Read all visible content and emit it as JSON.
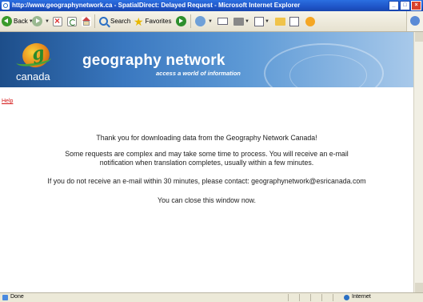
{
  "window": {
    "title": "http://www.geographynetwork.ca - SpatialDirect: Delayed Request - Microsoft Internet Explorer",
    "minimize_label": "_",
    "maximize_label": "□",
    "close_label": "×"
  },
  "toolbar": {
    "back_label": "Back",
    "search_label": "Search",
    "favorites_label": "Favorites"
  },
  "banner": {
    "logo_letter": "g",
    "logo_text": "canada",
    "site_title": "geography network",
    "tagline": "access a world of information"
  },
  "page": {
    "help_link": "Help",
    "message_1": "Thank you for downloading data from the Geography Network Canada!",
    "message_2_line_1": "Some requests are complex and may take some time to process. You will receive an e-mail",
    "message_2_line_2": "notification when translation completes, usually within a few minutes.",
    "message_3": "If you do not receive an e-mail within 30 minutes, please contact: geographynetwork@esricanada.com",
    "message_4": "You can close this window now."
  },
  "statusbar": {
    "status_text": "Done",
    "zone_text": "Internet"
  },
  "colors": {
    "titlebar": "#1f55c8",
    "banner_dark": "#1d4e8a",
    "help_link": "#d41818"
  }
}
